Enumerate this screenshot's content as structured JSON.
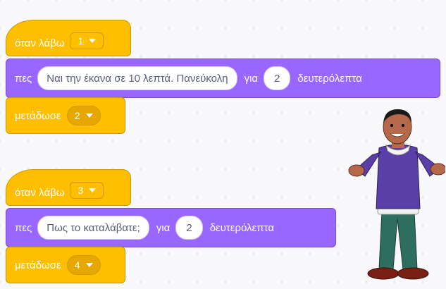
{
  "scripts": [
    {
      "hat_label": "όταν λάβω",
      "hat_value": "1",
      "say_label": "πες",
      "say_text": "Ναι την έκανα σε 10 λεπτά. Πανεύκολη",
      "say_for": "για",
      "say_secs": "2",
      "say_unit": "δευτερόλεπτα",
      "broadcast_label": "μετάδωσε",
      "broadcast_value": "2"
    },
    {
      "hat_label": "όταν λάβω",
      "hat_value": "3",
      "say_label": "πες",
      "say_text": "Πως το καταλάβατε;",
      "say_for": "για",
      "say_secs": "2",
      "say_unit": "δευτερόλεπτα",
      "broadcast_label": "μετάδωσε",
      "broadcast_value": "4"
    }
  ],
  "colors": {
    "events": "#ffbf00",
    "looks": "#9966ff",
    "canvas": "#f9f9fb"
  },
  "sprite": {
    "icon": "shrugging-man-sprite"
  }
}
